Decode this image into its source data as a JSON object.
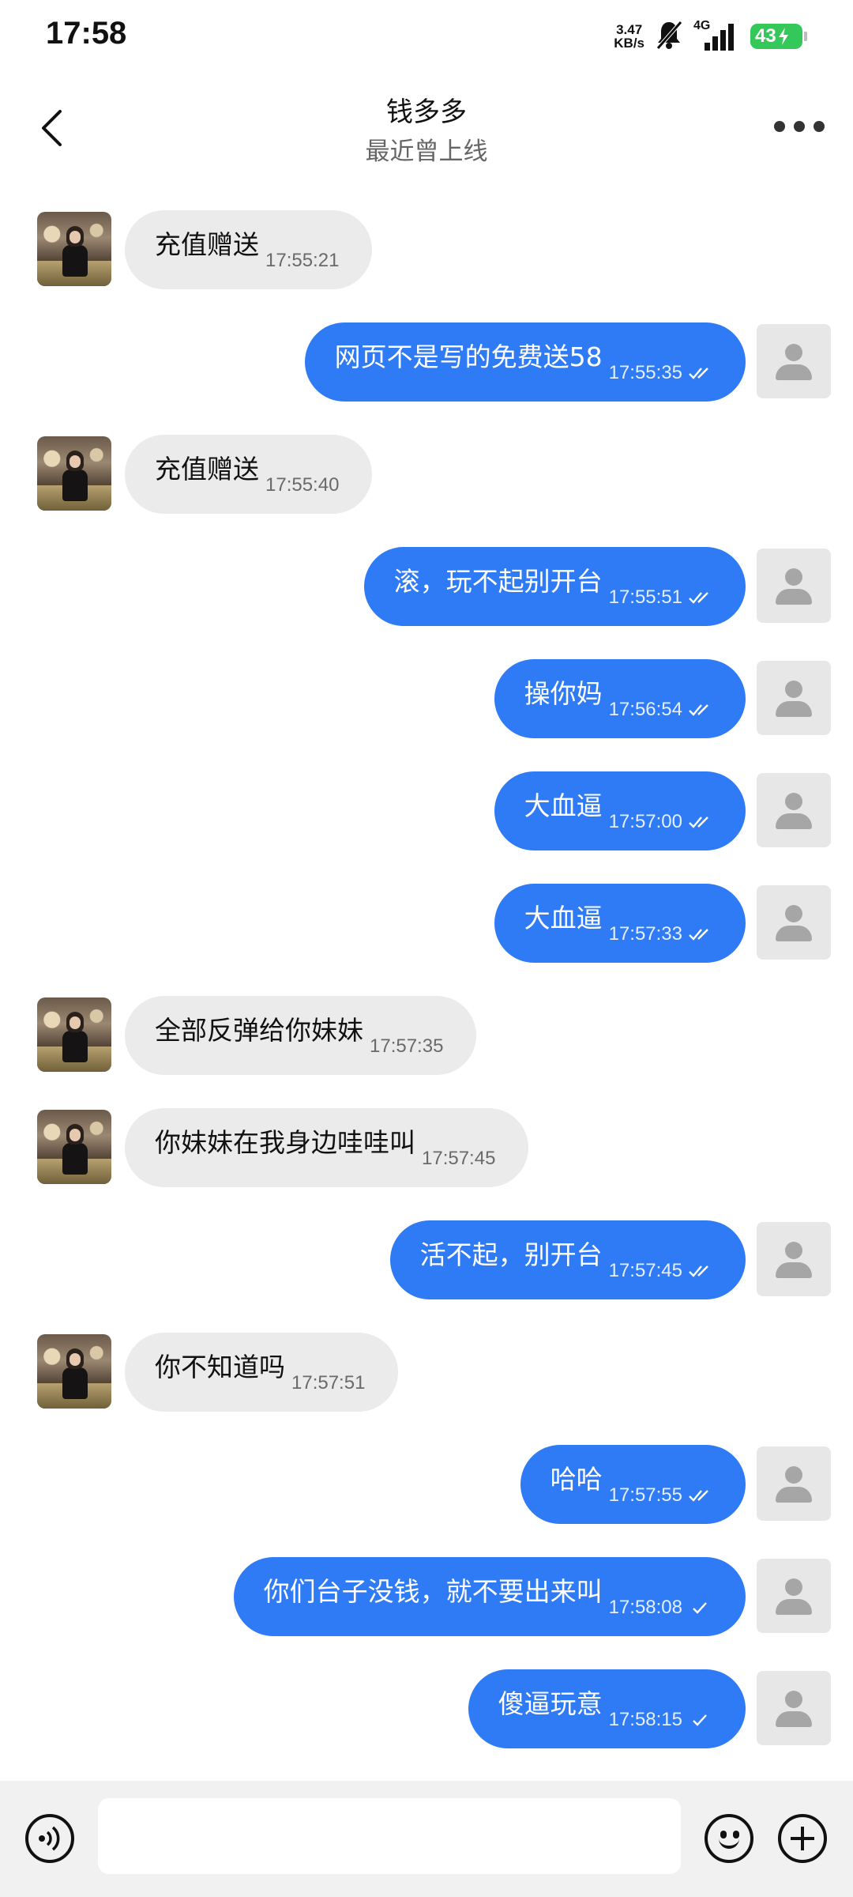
{
  "status_bar": {
    "time": "17:58",
    "net_speed_value": "3.47",
    "net_speed_unit": "KB/s",
    "network_type": "4G",
    "battery": "43"
  },
  "header": {
    "title": "钱多多",
    "subtitle": "最近曾上线"
  },
  "colors": {
    "outgoing_bubble": "#2f7bf6",
    "incoming_bubble": "#ebebeb",
    "battery": "#34c759"
  },
  "messages": [
    {
      "direction": "in",
      "text": "充值赠送",
      "time": "17:55:21"
    },
    {
      "direction": "out",
      "text": "网页不是写的免费送58",
      "time": "17:55:35",
      "status": "read"
    },
    {
      "direction": "in",
      "text": "充值赠送",
      "time": "17:55:40"
    },
    {
      "direction": "out",
      "text": "滚，玩不起别开台",
      "time": "17:55:51",
      "status": "read"
    },
    {
      "direction": "out",
      "text": "操你妈",
      "time": "17:56:54",
      "status": "read"
    },
    {
      "direction": "out",
      "text": "大血逼",
      "time": "17:57:00",
      "status": "read"
    },
    {
      "direction": "out",
      "text": "大血逼",
      "time": "17:57:33",
      "status": "read"
    },
    {
      "direction": "in",
      "text": "全部反弹给你妹妹",
      "time": "17:57:35"
    },
    {
      "direction": "in",
      "text": "你妹妹在我身边哇哇叫",
      "time": "17:57:45"
    },
    {
      "direction": "out",
      "text": "活不起，别开台",
      "time": "17:57:45",
      "status": "read"
    },
    {
      "direction": "in",
      "text": "你不知道吗",
      "time": "17:57:51"
    },
    {
      "direction": "out",
      "text": "哈哈",
      "time": "17:57:55",
      "status": "read"
    },
    {
      "direction": "out",
      "text": "你们台子没钱，就不要出来叫",
      "time": "17:58:08",
      "status": "sent"
    },
    {
      "direction": "out",
      "text": "傻逼玩意",
      "time": "17:58:15",
      "status": "sent"
    }
  ],
  "composer": {
    "input_value": "",
    "placeholder": ""
  },
  "icons": {
    "back": "chevron-left-icon",
    "more": "more-dots-icon",
    "voice": "voice-icon",
    "emoji": "emoji-icon",
    "plus": "plus-icon"
  }
}
